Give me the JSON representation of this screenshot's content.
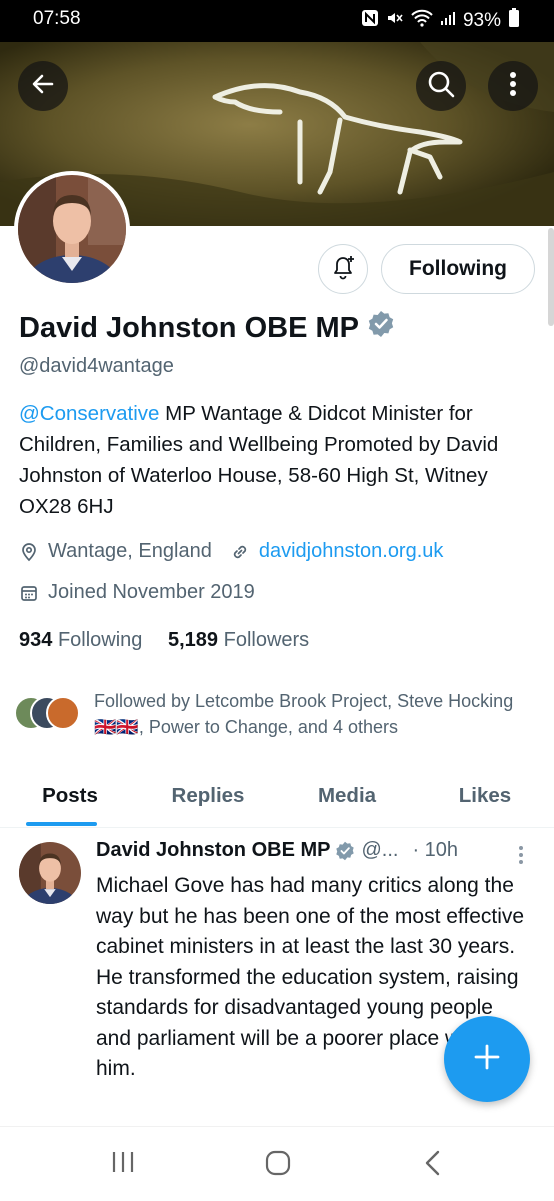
{
  "status_bar": {
    "time": "07:58",
    "battery": "93%",
    "icons": [
      "nfc-icon",
      "mute-icon",
      "wifi-icon",
      "signal-icon",
      "battery-icon"
    ]
  },
  "header": {
    "back_icon": "arrow-left-icon",
    "search_icon": "search-icon",
    "more_icon": "vertical-dots-icon"
  },
  "profile": {
    "notify_icon": "bell-plus-icon",
    "follow_button": "Following",
    "name": "David Johnston OBE MP",
    "verified_icon": "verified-badge-icon",
    "handle": "@david4wantage",
    "bio_mention": "@Conservative",
    "bio_text": " MP Wantage & Didcot   Minister for Children, Families and Wellbeing   Promoted by David Johnston of Waterloo House, 58-60 High St, Witney OX28 6HJ",
    "location": "Wantage, England",
    "website": "davidjohnston.org.uk",
    "joined": "Joined November 2019",
    "following_count": "934",
    "following_label": "Following",
    "followers_count": "5,189",
    "followers_label": "Followers",
    "followed_by": "Followed by Letcombe Brook Project, Steve Hocking 🇬🇧🇬🇧, Power to Change, and 4 others"
  },
  "tabs": [
    {
      "label": "Posts",
      "active": true
    },
    {
      "label": "Replies",
      "active": false
    },
    {
      "label": "Media",
      "active": false
    },
    {
      "label": "Likes",
      "active": false
    }
  ],
  "post": {
    "author": "David Johnston OBE MP",
    "handle": "@...",
    "time": "· 10h",
    "text": "Michael Gove has had many critics along the way but he has been one of the most effective cabinet ministers in at least the last 30 years. He transformed the education system, raising standards for disadvantaged young people and parliament will be a poorer place without him."
  },
  "fab_icon": "plus-icon",
  "nav_bar": [
    "recent-apps-icon",
    "home-icon",
    "back-icon"
  ],
  "colors": {
    "accent": "#1d9bf0",
    "text": "#0f1419",
    "secondary": "#536471",
    "border": "#cfd9de"
  }
}
